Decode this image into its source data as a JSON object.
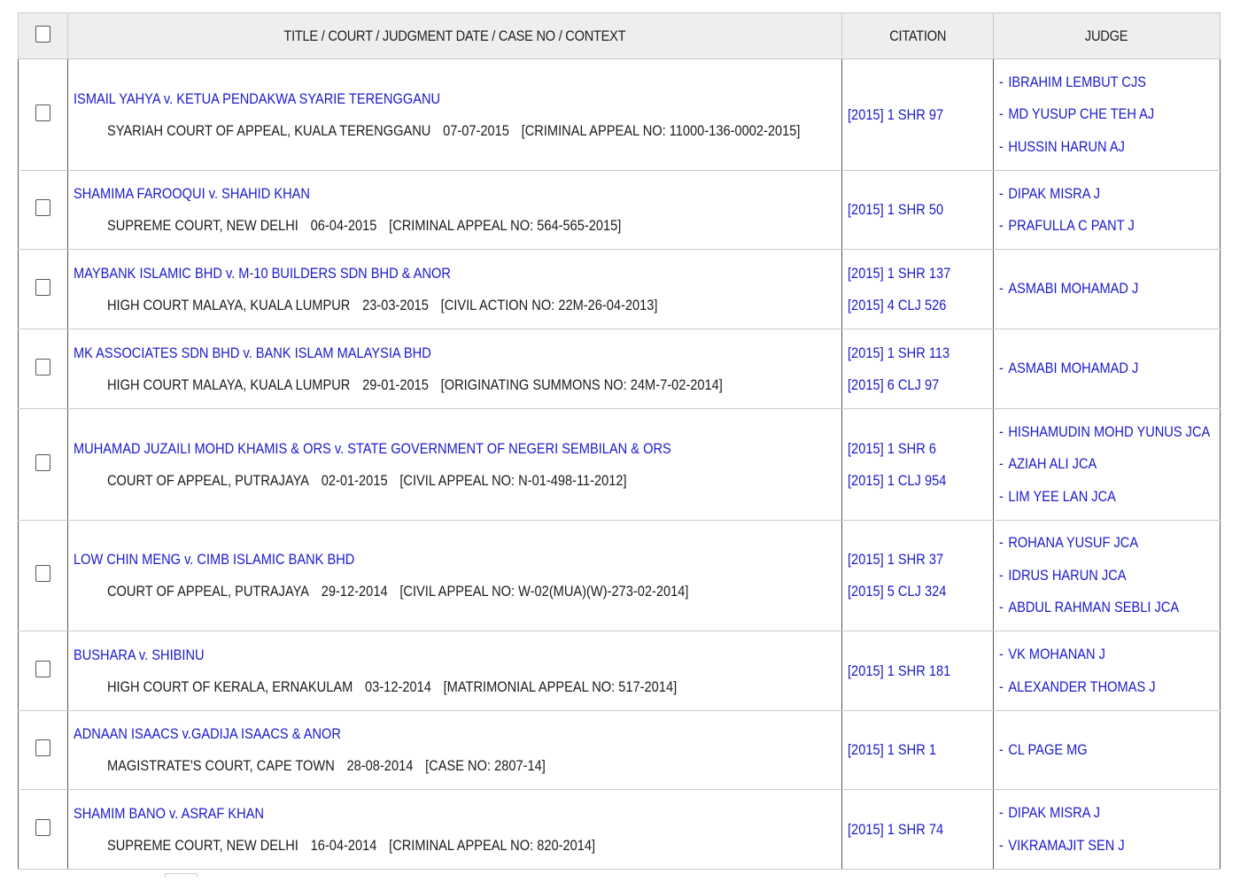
{
  "header": {
    "title_col": "TITLE / COURT / JUDGMENT DATE / CASE NO / CONTEXT",
    "citation_col": "CITATION",
    "judge_col": "JUDGE"
  },
  "cases": [
    {
      "title": "ISMAIL YAHYA v. KETUA PENDAKWA SYARIE TERENGGANU",
      "court": "SYARIAH COURT OF APPEAL, KUALA TERENGGANU",
      "date": "07-07-2015",
      "case_no": "[CRIMINAL APPEAL NO: 11000-136-0002-2015]",
      "citations": [
        "[2015] 1 SHR 97"
      ],
      "judges": [
        "IBRAHIM LEMBUT CJS",
        "MD YUSUP CHE TEH AJ",
        "HUSSIN HARUN AJ"
      ]
    },
    {
      "title": "SHAMIMA FAROOQUI v. SHAHID KHAN",
      "court": "SUPREME COURT, NEW DELHI",
      "date": "06-04-2015",
      "case_no": "[CRIMINAL APPEAL NO: 564-565-2015]",
      "citations": [
        "[2015] 1 SHR 50"
      ],
      "judges": [
        "DIPAK MISRA J",
        "PRAFULLA C PANT J"
      ]
    },
    {
      "title": "MAYBANK ISLAMIC BHD v. M-10 BUILDERS SDN BHD & ANOR",
      "court": "HIGH COURT MALAYA, KUALA LUMPUR",
      "date": "23-03-2015",
      "case_no": "[CIVIL ACTION NO: 22M-26-04-2013]",
      "citations": [
        "[2015] 1 SHR 137",
        "[2015] 4 CLJ 526"
      ],
      "judges": [
        "ASMABI MOHAMAD J"
      ]
    },
    {
      "title": "MK ASSOCIATES SDN BHD v. BANK ISLAM MALAYSIA BHD",
      "court": "HIGH COURT MALAYA, KUALA LUMPUR",
      "date": "29-01-2015",
      "case_no": "[ORIGINATING SUMMONS NO: 24M-7-02-2014]",
      "citations": [
        "[2015] 1 SHR 113",
        "[2015] 6 CLJ 97"
      ],
      "judges": [
        "ASMABI MOHAMAD J"
      ]
    },
    {
      "title": "MUHAMAD JUZAILI MOHD KHAMIS & ORS v. STATE GOVERNMENT OF NEGERI SEMBILAN & ORS",
      "court": "COURT OF APPEAL, PUTRAJAYA",
      "date": "02-01-2015",
      "case_no": "[CIVIL APPEAL NO: N-01-498-11-2012]",
      "citations": [
        "[2015] 1 SHR 6",
        "[2015] 1 CLJ 954"
      ],
      "judges": [
        "HISHAMUDIN MOHD YUNUS JCA",
        "AZIAH ALI JCA",
        "LIM YEE LAN JCA"
      ]
    },
    {
      "title": "LOW CHIN MENG v. CIMB ISLAMIC BANK BHD",
      "court": "COURT OF APPEAL, PUTRAJAYA",
      "date": "29-12-2014",
      "case_no": "[CIVIL APPEAL NO: W-02(MUA)(W)-273-02-2014]",
      "citations": [
        "[2015] 1 SHR 37",
        "[2015] 5 CLJ 324"
      ],
      "judges": [
        "ROHANA YUSUF JCA",
        "IDRUS HARUN JCA",
        "ABDUL RAHMAN SEBLI JCA"
      ]
    },
    {
      "title": "BUSHARA v. SHIBINU",
      "court": "HIGH COURT OF KERALA, ERNAKULAM",
      "date": "03-12-2014",
      "case_no": "[MATRIMONIAL APPEAL NO: 517-2014]",
      "citations": [
        "[2015] 1 SHR 181"
      ],
      "judges": [
        "VK MOHANAN J",
        "ALEXANDER THOMAS J"
      ]
    },
    {
      "title": "ADNAAN ISAACS v.GADIJA ISAACS & ANOR",
      "court": "MAGISTRATE'S COURT, CAPE TOWN",
      "date": "28-08-2014",
      "case_no": "[CASE NO: 2807-14]",
      "citations": [
        "[2015] 1 SHR 1"
      ],
      "judges": [
        "CL PAGE MG"
      ]
    },
    {
      "title": "SHAMIM BANO v. ASRAF KHAN",
      "court": "SUPREME COURT, NEW DELHI",
      "date": "16-04-2014",
      "case_no": "[CRIMINAL APPEAL NO: 820-2014]",
      "citations": [
        "[2015] 1 SHR 74"
      ],
      "judges": [
        "DIPAK MISRA J",
        "VIKRAMAJIT SEN J"
      ]
    }
  ]
}
